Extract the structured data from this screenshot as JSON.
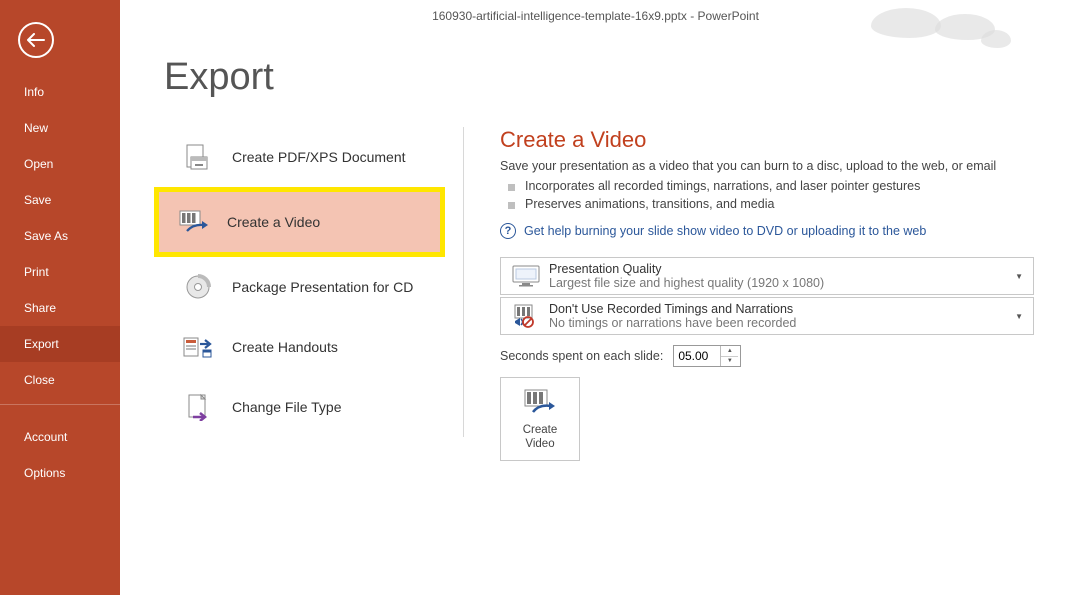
{
  "window": {
    "title": "160930-artificial-intelligence-template-16x9.pptx - PowerPoint"
  },
  "sidebar": {
    "items": [
      {
        "label": "Info",
        "active": false
      },
      {
        "label": "New",
        "active": false
      },
      {
        "label": "Open",
        "active": false
      },
      {
        "label": "Save",
        "active": false
      },
      {
        "label": "Save As",
        "active": false
      },
      {
        "label": "Print",
        "active": false
      },
      {
        "label": "Share",
        "active": false
      },
      {
        "label": "Export",
        "active": true
      },
      {
        "label": "Close",
        "active": false
      }
    ],
    "bottom_items": [
      {
        "label": "Account"
      },
      {
        "label": "Options"
      }
    ]
  },
  "page": {
    "title": "Export"
  },
  "export_options": [
    {
      "id": "pdfxps",
      "label": "Create PDF/XPS Document",
      "selected": false,
      "highlighted": false,
      "icon": "pdf-xps-icon"
    },
    {
      "id": "video",
      "label": "Create a Video",
      "selected": true,
      "highlighted": true,
      "icon": "video-icon"
    },
    {
      "id": "cd",
      "label": "Package Presentation for CD",
      "selected": false,
      "highlighted": false,
      "icon": "cd-icon"
    },
    {
      "id": "handouts",
      "label": "Create Handouts",
      "selected": false,
      "highlighted": false,
      "icon": "handouts-icon"
    },
    {
      "id": "filetype",
      "label": "Change File Type",
      "selected": false,
      "highlighted": false,
      "icon": "filetype-icon"
    }
  ],
  "detail": {
    "title": "Create a Video",
    "subtitle": "Save your presentation as a video that you can burn to a disc, upload to the web, or email",
    "bullets": [
      "Incorporates all recorded timings, narrations, and laser pointer gestures",
      "Preserves animations, transitions, and media"
    ],
    "help_link": "Get help burning your slide show video to DVD or uploading it to the web",
    "quality": {
      "title": "Presentation Quality",
      "sub": "Largest file size and highest quality (1920 x 1080)"
    },
    "timings": {
      "title": "Don't Use Recorded Timings and Narrations",
      "sub": "No timings or narrations have been recorded"
    },
    "seconds_label": "Seconds spent on each slide:",
    "seconds_value": "05.00",
    "create_button": "Create\nVideo"
  }
}
